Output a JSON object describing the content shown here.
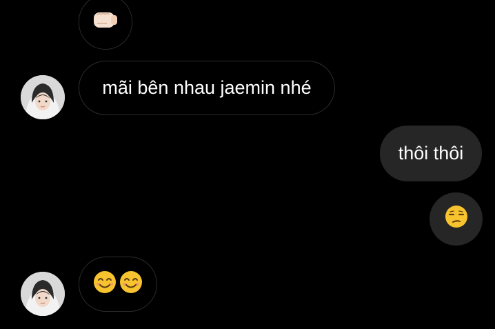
{
  "thread": {
    "messages": [
      {
        "id": "m1",
        "direction": "incoming",
        "kind": "emoji",
        "icon": "fist-bump-icon",
        "avatar": false
      },
      {
        "id": "m2",
        "direction": "incoming",
        "kind": "text",
        "text": "mãi bên nhau jaemin nhé",
        "avatar": true
      },
      {
        "id": "m3",
        "direction": "outgoing",
        "kind": "text",
        "text": "thôi thôi",
        "avatar": false
      },
      {
        "id": "m4",
        "direction": "outgoing",
        "kind": "emoji",
        "icon": "unamused-face-icon",
        "avatar": false
      },
      {
        "id": "m5",
        "direction": "incoming",
        "kind": "emoji",
        "icons": [
          "smiling-face-icon",
          "smiling-face-icon"
        ],
        "avatar": true
      }
    ]
  },
  "colors": {
    "background": "#000000",
    "incoming_border": "#2c2c2c",
    "outgoing_bubble": "#262626",
    "text": "#ffffff",
    "emoji_yellow": "#f7c32e"
  }
}
